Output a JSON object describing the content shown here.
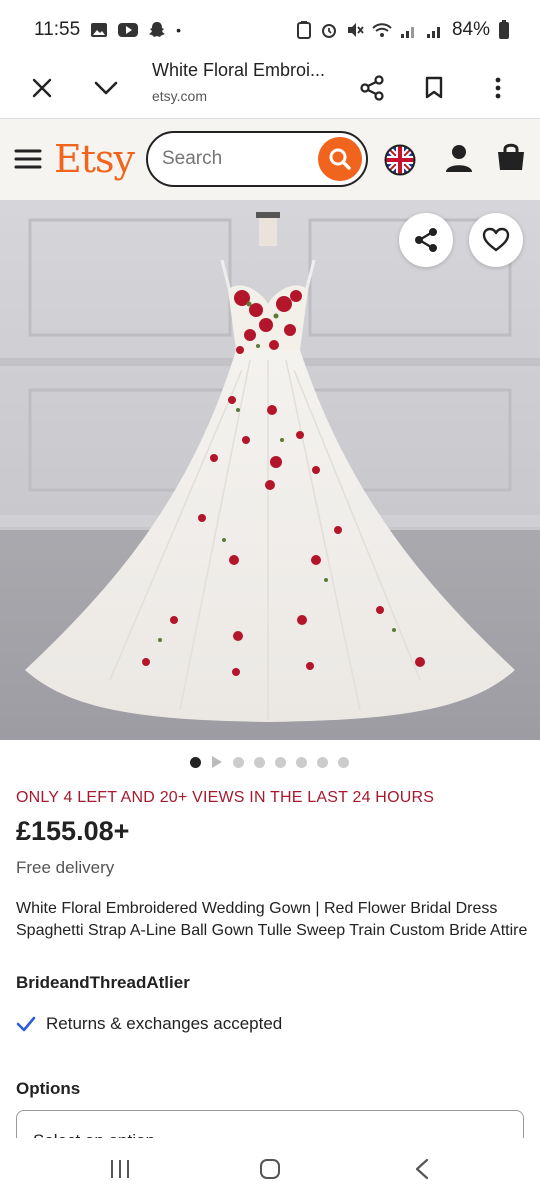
{
  "status_bar": {
    "time": "11:55",
    "battery": "84%"
  },
  "browser": {
    "page_title": "White Floral Embroi...",
    "url": "etsy.com"
  },
  "etsy": {
    "logo": "Etsy",
    "search_placeholder": "Search",
    "accent_color": "#f1641e"
  },
  "product": {
    "image_count": 8,
    "active_image_index": 0,
    "urgency": "ONLY 4 LEFT AND 20+ VIEWS IN THE LAST 24 HOURS",
    "price": "£155.08+",
    "delivery": "Free delivery",
    "title": "White Floral Embroidered Wedding Gown | Red Flower Bridal Dress Spaghetti Strap A-Line Ball Gown Tulle Sweep Train Custom Bride Attire",
    "shop_name": "BrideandThreadAtlier",
    "returns": "Returns & exchanges accepted"
  },
  "options": {
    "heading": "Options",
    "select_label": "Select an option"
  }
}
